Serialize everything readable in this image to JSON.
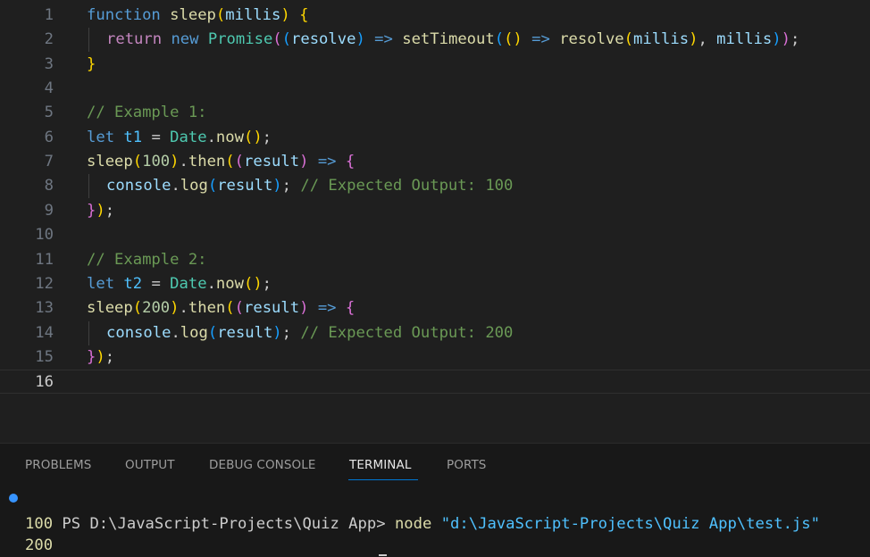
{
  "editor": {
    "current_line": 16,
    "lines": [
      {
        "num": "1",
        "indent": false,
        "tokens": [
          [
            "function",
            "#569cd6"
          ],
          [
            " ",
            "#cccccc"
          ],
          [
            "sleep",
            "#dcdcaa"
          ],
          [
            "(",
            "#ffd700"
          ],
          [
            "millis",
            "#9cdcfe"
          ],
          [
            ")",
            "#ffd700"
          ],
          [
            " ",
            "#cccccc"
          ],
          [
            "{",
            "#ffd700"
          ]
        ]
      },
      {
        "num": "2",
        "indent": true,
        "tokens": [
          [
            "return",
            "#c586c0"
          ],
          [
            " ",
            "#cccccc"
          ],
          [
            "new",
            "#569cd6"
          ],
          [
            " ",
            "#cccccc"
          ],
          [
            "Promise",
            "#4ec9b0"
          ],
          [
            "(",
            "#da70d6"
          ],
          [
            "(",
            "#179fff"
          ],
          [
            "resolve",
            "#9cdcfe"
          ],
          [
            ")",
            "#179fff"
          ],
          [
            " ",
            "#cccccc"
          ],
          [
            "=>",
            "#569cd6"
          ],
          [
            " ",
            "#cccccc"
          ],
          [
            "setTimeout",
            "#dcdcaa"
          ],
          [
            "(",
            "#179fff"
          ],
          [
            "()",
            "#ffd700"
          ],
          [
            " ",
            "#cccccc"
          ],
          [
            "=>",
            "#569cd6"
          ],
          [
            " ",
            "#cccccc"
          ],
          [
            "resolve",
            "#dcdcaa"
          ],
          [
            "(",
            "#ffd700"
          ],
          [
            "millis",
            "#9cdcfe"
          ],
          [
            ")",
            "#ffd700"
          ],
          [
            ", ",
            "#cccccc"
          ],
          [
            "millis",
            "#9cdcfe"
          ],
          [
            ")",
            "#179fff"
          ],
          [
            ")",
            "#da70d6"
          ],
          [
            ";",
            "#cccccc"
          ]
        ]
      },
      {
        "num": "3",
        "indent": false,
        "tokens": [
          [
            "}",
            "#ffd700"
          ]
        ]
      },
      {
        "num": "4",
        "indent": false,
        "tokens": []
      },
      {
        "num": "5",
        "indent": false,
        "tokens": [
          [
            "// Example 1:",
            "#6a9955"
          ]
        ]
      },
      {
        "num": "6",
        "indent": false,
        "tokens": [
          [
            "let",
            "#569cd6"
          ],
          [
            " ",
            "#cccccc"
          ],
          [
            "t1",
            "#4fc1ff"
          ],
          [
            " = ",
            "#cccccc"
          ],
          [
            "Date",
            "#4ec9b0"
          ],
          [
            ".",
            "#cccccc"
          ],
          [
            "now",
            "#dcdcaa"
          ],
          [
            "()",
            "#ffd700"
          ],
          [
            ";",
            "#cccccc"
          ]
        ]
      },
      {
        "num": "7",
        "indent": false,
        "tokens": [
          [
            "sleep",
            "#dcdcaa"
          ],
          [
            "(",
            "#ffd700"
          ],
          [
            "100",
            "#b5cea8"
          ],
          [
            ")",
            "#ffd700"
          ],
          [
            ".",
            "#cccccc"
          ],
          [
            "then",
            "#dcdcaa"
          ],
          [
            "(",
            "#ffd700"
          ],
          [
            "(",
            "#da70d6"
          ],
          [
            "result",
            "#9cdcfe"
          ],
          [
            ")",
            "#da70d6"
          ],
          [
            " ",
            "#cccccc"
          ],
          [
            "=>",
            "#569cd6"
          ],
          [
            " ",
            "#cccccc"
          ],
          [
            "{",
            "#da70d6"
          ]
        ]
      },
      {
        "num": "8",
        "indent": true,
        "tokens": [
          [
            "console",
            "#9cdcfe"
          ],
          [
            ".",
            "#cccccc"
          ],
          [
            "log",
            "#dcdcaa"
          ],
          [
            "(",
            "#179fff"
          ],
          [
            "result",
            "#9cdcfe"
          ],
          [
            ")",
            "#179fff"
          ],
          [
            "; ",
            "#cccccc"
          ],
          [
            "// Expected Output: 100",
            "#6a9955"
          ]
        ]
      },
      {
        "num": "9",
        "indent": false,
        "tokens": [
          [
            "}",
            "#da70d6"
          ],
          [
            ")",
            "#ffd700"
          ],
          [
            ";",
            "#cccccc"
          ]
        ]
      },
      {
        "num": "10",
        "indent": false,
        "tokens": []
      },
      {
        "num": "11",
        "indent": false,
        "tokens": [
          [
            "// Example 2:",
            "#6a9955"
          ]
        ]
      },
      {
        "num": "12",
        "indent": false,
        "tokens": [
          [
            "let",
            "#569cd6"
          ],
          [
            " ",
            "#cccccc"
          ],
          [
            "t2",
            "#4fc1ff"
          ],
          [
            " = ",
            "#cccccc"
          ],
          [
            "Date",
            "#4ec9b0"
          ],
          [
            ".",
            "#cccccc"
          ],
          [
            "now",
            "#dcdcaa"
          ],
          [
            "()",
            "#ffd700"
          ],
          [
            ";",
            "#cccccc"
          ]
        ]
      },
      {
        "num": "13",
        "indent": false,
        "tokens": [
          [
            "sleep",
            "#dcdcaa"
          ],
          [
            "(",
            "#ffd700"
          ],
          [
            "200",
            "#b5cea8"
          ],
          [
            ")",
            "#ffd700"
          ],
          [
            ".",
            "#cccccc"
          ],
          [
            "then",
            "#dcdcaa"
          ],
          [
            "(",
            "#ffd700"
          ],
          [
            "(",
            "#da70d6"
          ],
          [
            "result",
            "#9cdcfe"
          ],
          [
            ")",
            "#da70d6"
          ],
          [
            " ",
            "#cccccc"
          ],
          [
            "=>",
            "#569cd6"
          ],
          [
            " ",
            "#cccccc"
          ],
          [
            "{",
            "#da70d6"
          ]
        ]
      },
      {
        "num": "14",
        "indent": true,
        "tokens": [
          [
            "console",
            "#9cdcfe"
          ],
          [
            ".",
            "#cccccc"
          ],
          [
            "log",
            "#dcdcaa"
          ],
          [
            "(",
            "#179fff"
          ],
          [
            "result",
            "#9cdcfe"
          ],
          [
            ")",
            "#179fff"
          ],
          [
            "; ",
            "#cccccc"
          ],
          [
            "// Expected Output: 200",
            "#6a9955"
          ]
        ]
      },
      {
        "num": "15",
        "indent": false,
        "tokens": [
          [
            "}",
            "#da70d6"
          ],
          [
            ")",
            "#ffd700"
          ],
          [
            ";",
            "#cccccc"
          ]
        ]
      },
      {
        "num": "16",
        "indent": false,
        "tokens": []
      }
    ]
  },
  "panel": {
    "active_tab": "TERMINAL",
    "tabs": [
      "PROBLEMS",
      "OUTPUT",
      "DEBUG CONSOLE",
      "TERMINAL",
      "PORTS"
    ]
  },
  "terminal": {
    "prompt": "PS D:\\JavaScript-Projects\\Quiz App> ",
    "command": "node",
    "argument": "\"d:\\JavaScript-Projects\\Quiz App\\test.js\"",
    "output": [
      "100",
      "200"
    ]
  },
  "colors": {
    "prompt": "#cccccc",
    "command": "#dcdcaa",
    "argument": "#4fc1ff",
    "output": "#dcdcaa",
    "dot": "#3794ff"
  }
}
